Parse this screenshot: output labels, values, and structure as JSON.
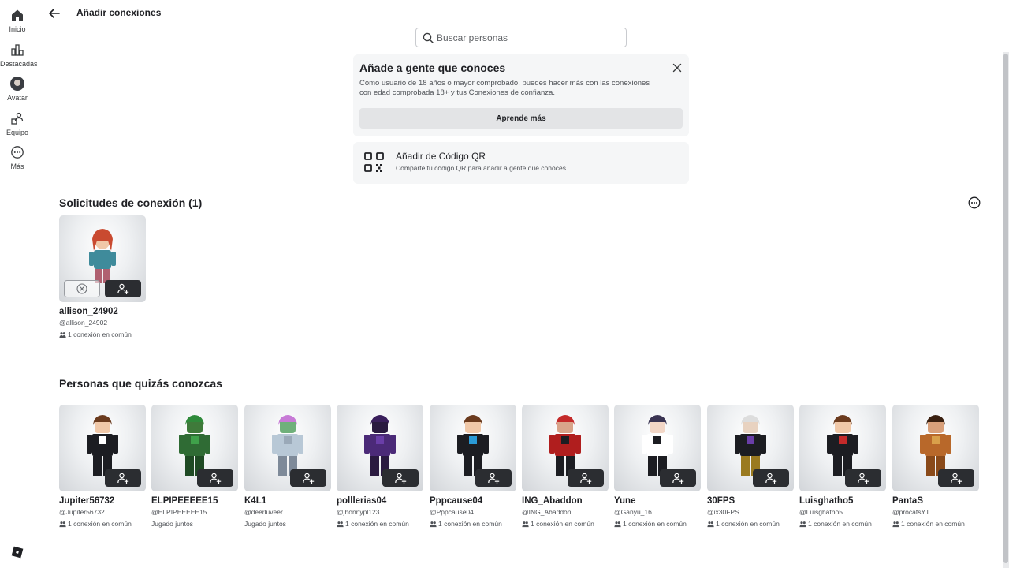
{
  "nav": {
    "items": [
      {
        "label": "Inicio",
        "icon": "home-icon"
      },
      {
        "label": "Destacadas",
        "icon": "charts-icon"
      },
      {
        "label": "Avatar",
        "icon": "avatar-icon"
      },
      {
        "label": "Equipo",
        "icon": "team-icon"
      },
      {
        "label": "Más",
        "icon": "more-icon"
      }
    ]
  },
  "header": {
    "title": "Añadir conexiones"
  },
  "search": {
    "placeholder": "Buscar personas",
    "value": ""
  },
  "info_card": {
    "title": "Añade a gente que conoces",
    "body": "Como usuario de 18 años o mayor comprobado, puedes hacer más con las conexiones con edad comprobada 18+ y tus Conexiones de confianza.",
    "button_label": "Aprende más"
  },
  "qr_card": {
    "title": "Añadir de Código QR",
    "subtitle": "Comparte tu código QR para añadir a gente que conoces"
  },
  "requests": {
    "title": "Solicitudes de conexión (1)",
    "items": [
      {
        "name": "allison_24902",
        "handle": "@allison_24902",
        "meta": "1 conexión en común",
        "meta_icon": "mutual-icon"
      }
    ]
  },
  "suggestions": {
    "title": "Personas que quizás conozcas",
    "items": [
      {
        "name": "Jupiter56732",
        "handle": "@Jupiter56732",
        "meta": "1 conexión en común",
        "meta_icon": "mutual-icon"
      },
      {
        "name": "ELPIPEEEEE15",
        "handle": "@ELPIPEEEEE15",
        "meta": "Jugado juntos",
        "meta_icon": ""
      },
      {
        "name": "K4L1",
        "handle": "@deerluveer",
        "meta": "Jugado juntos",
        "meta_icon": ""
      },
      {
        "name": "polllerias04",
        "handle": "@jhonnypl123",
        "meta": "1 conexión en común",
        "meta_icon": "mutual-icon"
      },
      {
        "name": "Pppcause04",
        "handle": "@Pppcause04",
        "meta": "1 conexión en común",
        "meta_icon": "mutual-icon"
      },
      {
        "name": "ING_Abaddon",
        "handle": "@ING_Abaddon",
        "meta": "1 conexión en común",
        "meta_icon": "mutual-icon"
      },
      {
        "name": "Yune",
        "handle": "@Ganyu_16",
        "meta": "1 conexión en común",
        "meta_icon": "mutual-icon"
      },
      {
        "name": "30FPS",
        "handle": "@ix30FPS",
        "meta": "1 conexión en común",
        "meta_icon": "mutual-icon"
      },
      {
        "name": "Luisghatho5",
        "handle": "@Luisghatho5",
        "meta": "1 conexión en común",
        "meta_icon": "mutual-icon"
      },
      {
        "name": "PantaS",
        "handle": "@procatsYT",
        "meta": "1 conexión en común",
        "meta_icon": "mutual-icon"
      }
    ]
  }
}
